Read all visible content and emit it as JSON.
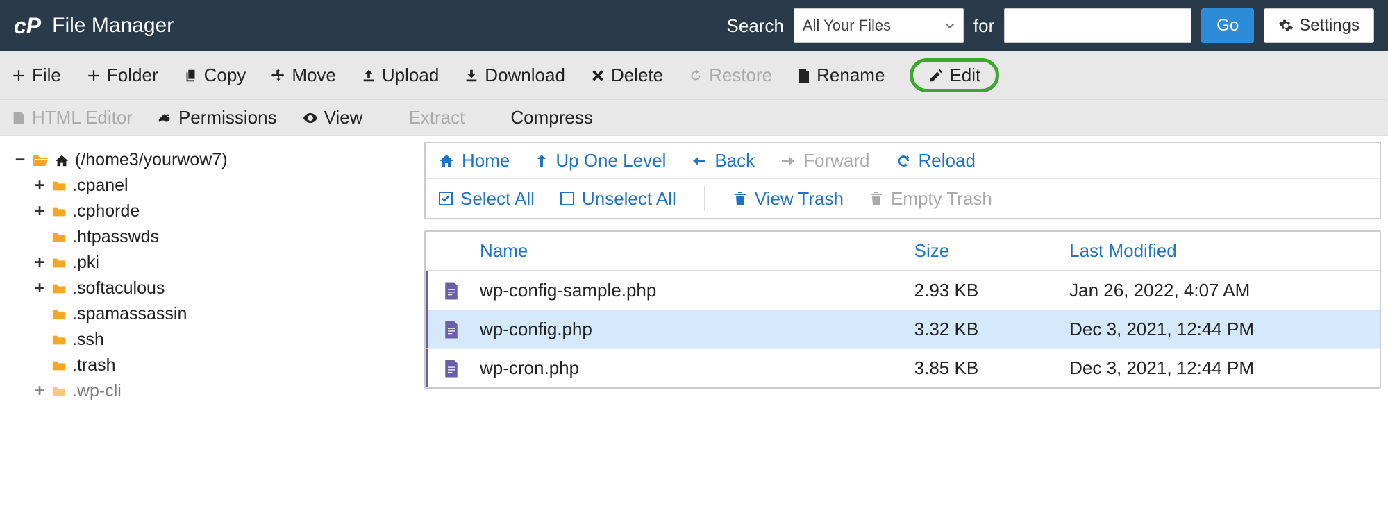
{
  "header": {
    "logo_text": "cP",
    "title": "File Manager",
    "search_label": "Search",
    "search_select_value": "All Your Files",
    "for_label": "for",
    "search_input_value": "",
    "go_label": "Go",
    "settings_label": "Settings"
  },
  "toolbar1": {
    "file": "File",
    "folder": "Folder",
    "copy": "Copy",
    "move": "Move",
    "upload": "Upload",
    "download": "Download",
    "delete": "Delete",
    "restore": "Restore",
    "rename": "Rename",
    "edit": "Edit"
  },
  "toolbar2": {
    "html_editor": "HTML Editor",
    "permissions": "Permissions",
    "view": "View",
    "extract": "Extract",
    "compress": "Compress"
  },
  "tree": {
    "root_expander": "−",
    "root_label": "(/home3/yourwow7)",
    "items": [
      {
        "expander": "+",
        "label": ".cpanel"
      },
      {
        "expander": "+",
        "label": ".cphorde"
      },
      {
        "expander": "",
        "label": ".htpasswds"
      },
      {
        "expander": "+",
        "label": ".pki"
      },
      {
        "expander": "+",
        "label": ".softaculous"
      },
      {
        "expander": "",
        "label": ".spamassassin"
      },
      {
        "expander": "",
        "label": ".ssh"
      },
      {
        "expander": "",
        "label": ".trash"
      },
      {
        "expander": "+",
        "label": ".wp-cli"
      }
    ]
  },
  "nav": {
    "home": "Home",
    "up": "Up One Level",
    "back": "Back",
    "forward": "Forward",
    "reload": "Reload",
    "select_all": "Select All",
    "unselect_all": "Unselect All",
    "view_trash": "View Trash",
    "empty_trash": "Empty Trash"
  },
  "table": {
    "headers": {
      "name": "Name",
      "size": "Size",
      "modified": "Last Modified"
    },
    "rows": [
      {
        "name": "wp-config-sample.php",
        "size": "2.93 KB",
        "modified": "Jan 26, 2022, 4:07 AM",
        "selected": false
      },
      {
        "name": "wp-config.php",
        "size": "3.32 KB",
        "modified": "Dec 3, 2021, 12:44 PM",
        "selected": true
      },
      {
        "name": "wp-cron.php",
        "size": "3.85 KB",
        "modified": "Dec 3, 2021, 12:44 PM",
        "selected": false
      }
    ]
  }
}
